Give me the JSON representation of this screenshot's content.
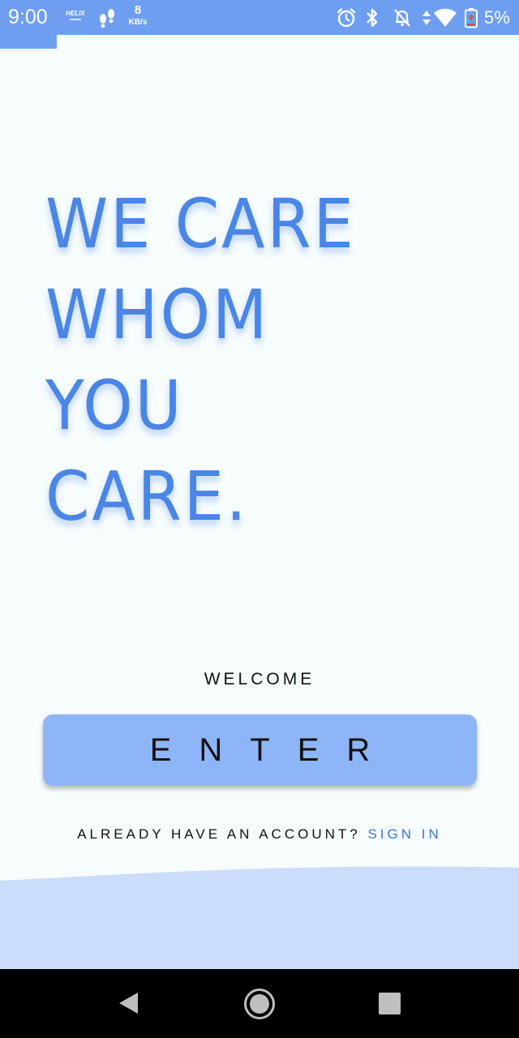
{
  "status_bar": {
    "time": "9:00",
    "helix_logo": "HELIX",
    "speed_value": "8",
    "speed_unit": "KB/s",
    "battery_percent": "5%",
    "icons": [
      "footsteps-icon",
      "alarm-icon",
      "bluetooth-icon",
      "notifications-off-icon",
      "data-arrows-icon",
      "wifi-icon",
      "battery-low-icon"
    ]
  },
  "headline": {
    "line1": "WE CARE",
    "line2": "WHOM",
    "line3": "YOU",
    "line4": "CARE."
  },
  "welcome_label": "WELCOME",
  "enter_button_label": "ENTER",
  "account_prompt": "ALREADY HAVE AN ACCOUNT?",
  "sign_in_label": "SIGN IN",
  "colors": {
    "accent": "#4a86e6",
    "status_bar": "#6d9ef0",
    "button": "#8fb5f9",
    "wave": "#ccdcfb",
    "link": "#3b74d6",
    "background": "#f7fcfd"
  },
  "nav_bar": {
    "icons": [
      "back-icon",
      "home-icon",
      "recents-icon"
    ]
  }
}
